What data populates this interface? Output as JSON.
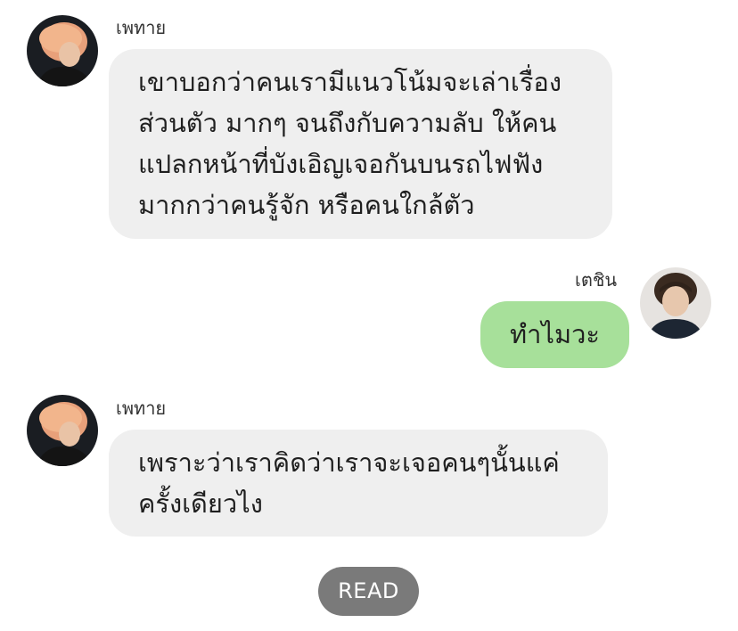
{
  "messages": [
    {
      "sender": "เพทาย",
      "direction": "incoming",
      "lines": [
        "เขาบอกว่าคนเรามีแนวโน้มจะเล่าเรื่อง",
        "ส่วนตัว มากๆ จนถึงกับความลับ  ให้คน",
        "แปลกหน้าที่บังเอิญเจอกันบนรถไฟฟัง",
        "มากกว่าคนรู้จัก หรือคนใกล้ตัว"
      ]
    },
    {
      "sender": "เตชิน",
      "direction": "outgoing",
      "lines": [
        "ทำไมวะ"
      ]
    },
    {
      "sender": "เพทาย",
      "direction": "incoming",
      "lines": [
        "เพราะว่าเราคิดว่าเราจะเจอคนๆนั้นแค่",
        "ครั้งเดียวไง"
      ]
    }
  ],
  "status": {
    "read_label": "READ"
  },
  "colors": {
    "incoming_bubble": "#efefef",
    "outgoing_bubble": "#a7e09a",
    "read_badge": "#7a7a7a"
  }
}
